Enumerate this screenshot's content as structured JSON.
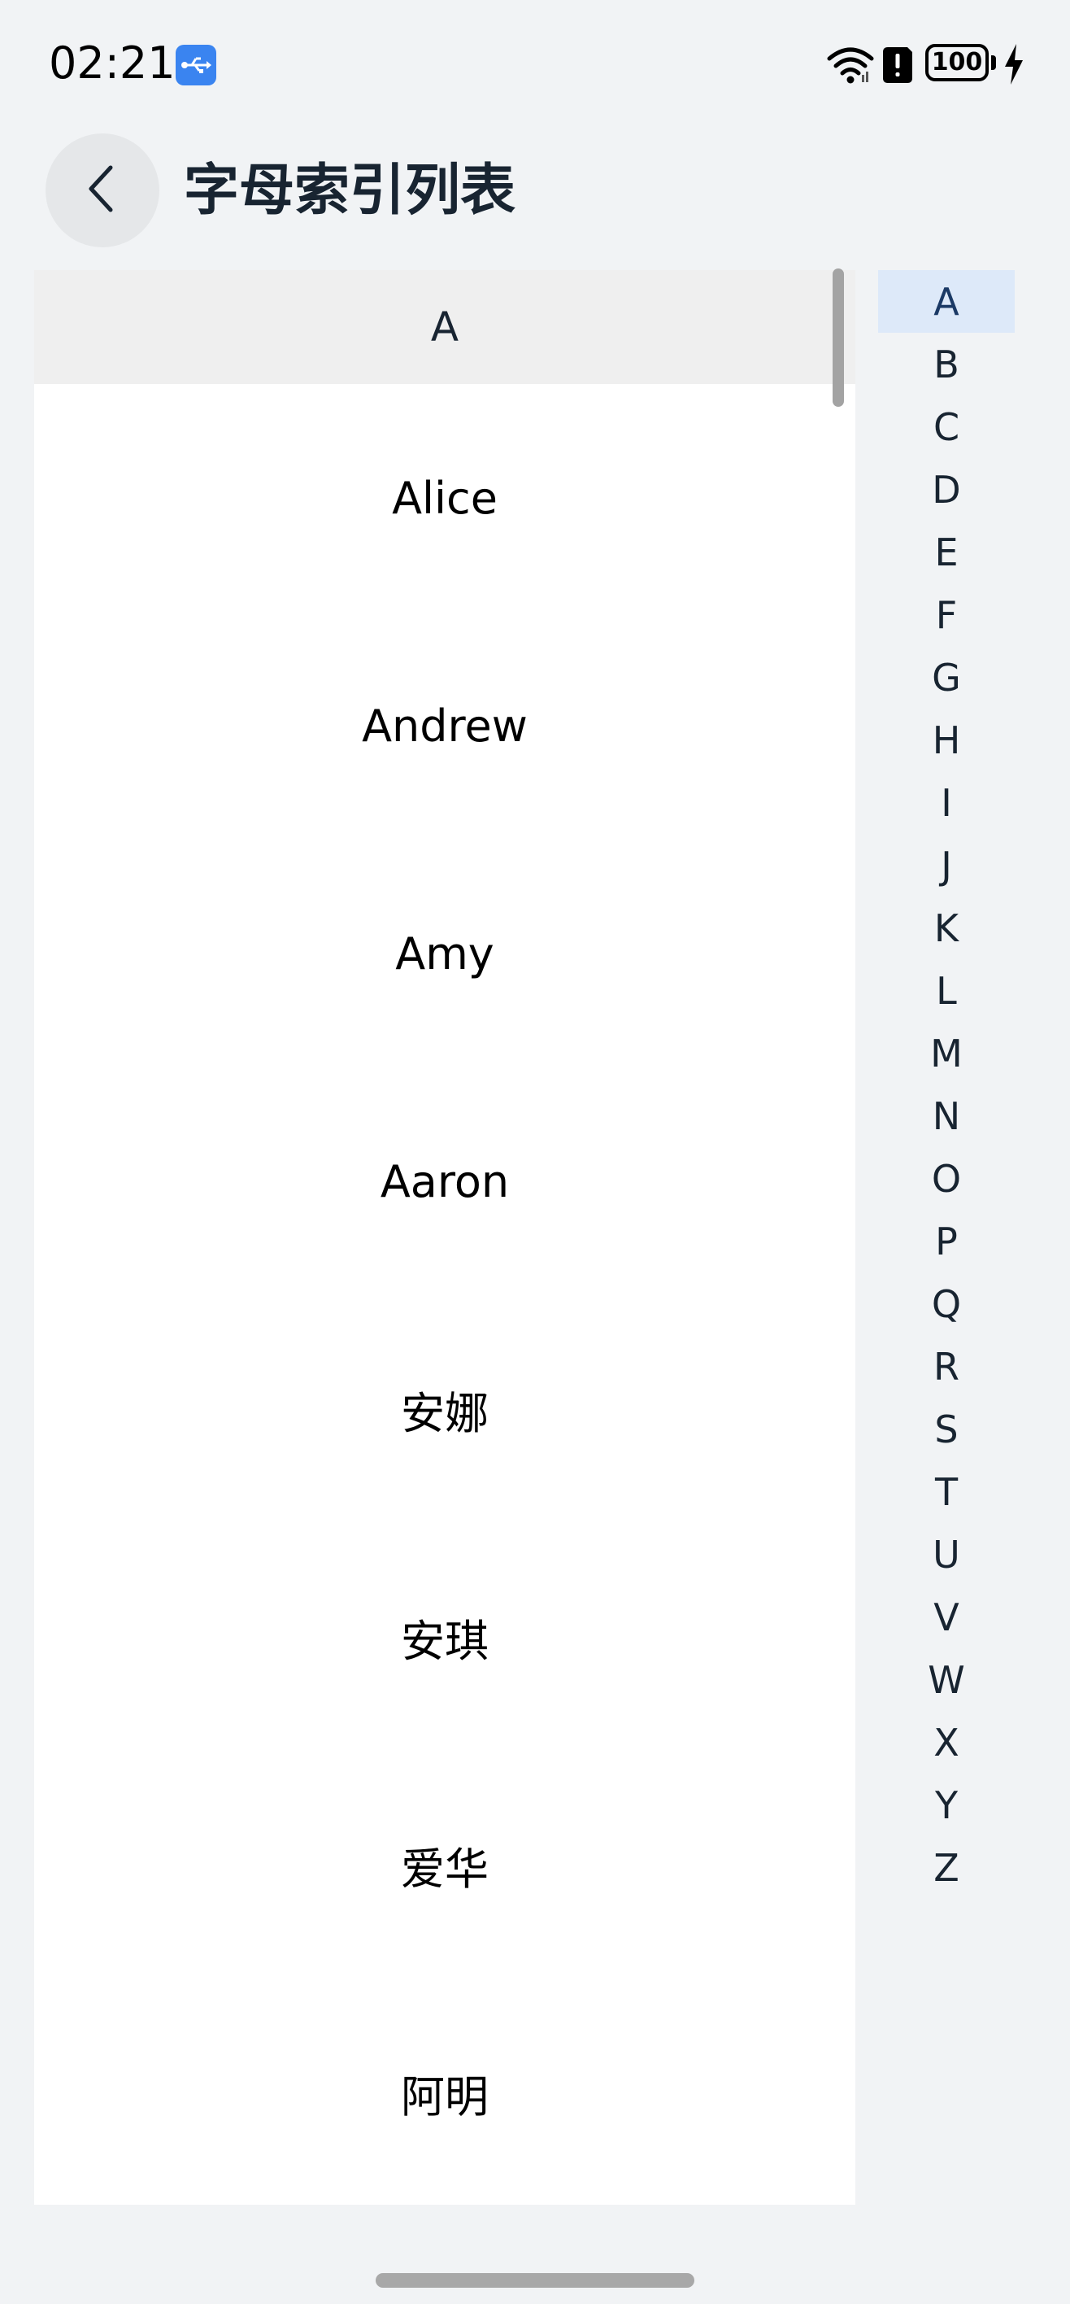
{
  "status_bar": {
    "time": "02:21",
    "usb_icon": "usb-debug-icon",
    "wifi_icon": "wifi-icon",
    "alert_icon": "alert-icon",
    "battery_level": "100",
    "charging_icon": "charging-bolt-icon"
  },
  "header": {
    "back_icon": "chevron-left-icon",
    "title": "字母索引列表"
  },
  "list": {
    "group_header": "A",
    "items": [
      "Alice",
      "Andrew",
      "Amy",
      "Aaron",
      "安娜",
      "安琪",
      "爱华",
      "阿明"
    ]
  },
  "index_bar": {
    "letters": [
      "A",
      "B",
      "C",
      "D",
      "E",
      "F",
      "G",
      "H",
      "I",
      "J",
      "K",
      "L",
      "M",
      "N",
      "O",
      "P",
      "Q",
      "R",
      "S",
      "T",
      "U",
      "V",
      "W",
      "X",
      "Y",
      "Z"
    ],
    "selected": "A"
  },
  "colors": {
    "background": "#f1f3f5",
    "list_background": "#ffffff",
    "group_header_background": "#efefef",
    "index_selected_background": "#dde9f9",
    "usb_badge": "#3a84f0"
  }
}
